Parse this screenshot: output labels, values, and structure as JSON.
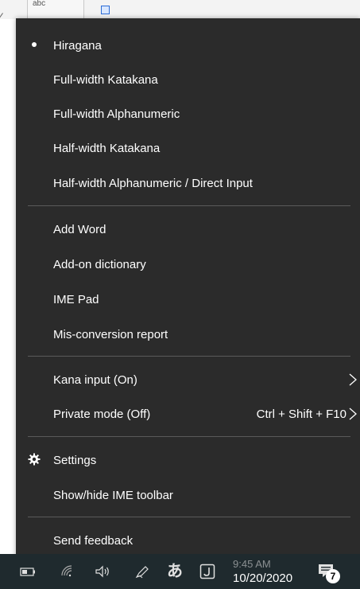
{
  "background": {
    "tab_label": "abc"
  },
  "menu": {
    "input_modes": [
      {
        "label": "Hiragana",
        "selected": true
      },
      {
        "label": "Full-width Katakana",
        "selected": false
      },
      {
        "label": "Full-width Alphanumeric",
        "selected": false
      },
      {
        "label": "Half-width Katakana",
        "selected": false
      },
      {
        "label": "Half-width Alphanumeric / Direct Input",
        "selected": false
      }
    ],
    "tools": [
      {
        "label": "Add Word"
      },
      {
        "label": "Add-on dictionary"
      },
      {
        "label": "IME Pad"
      },
      {
        "label": "Mis-conversion report"
      }
    ],
    "options": [
      {
        "label": "Kana input (On)",
        "shortcut": ""
      },
      {
        "label": "Private mode (Off)",
        "shortcut": "Ctrl + Shift + F10"
      }
    ],
    "settings": [
      {
        "label": "Settings",
        "icon": "gear-icon"
      },
      {
        "label": "Show/hide IME toolbar"
      }
    ],
    "feedback": {
      "label": "Send feedback"
    }
  },
  "taskbar": {
    "ime_indicator": "あ",
    "time": "9:45 AM",
    "date": "10/20/2020",
    "notification_count": "7"
  }
}
